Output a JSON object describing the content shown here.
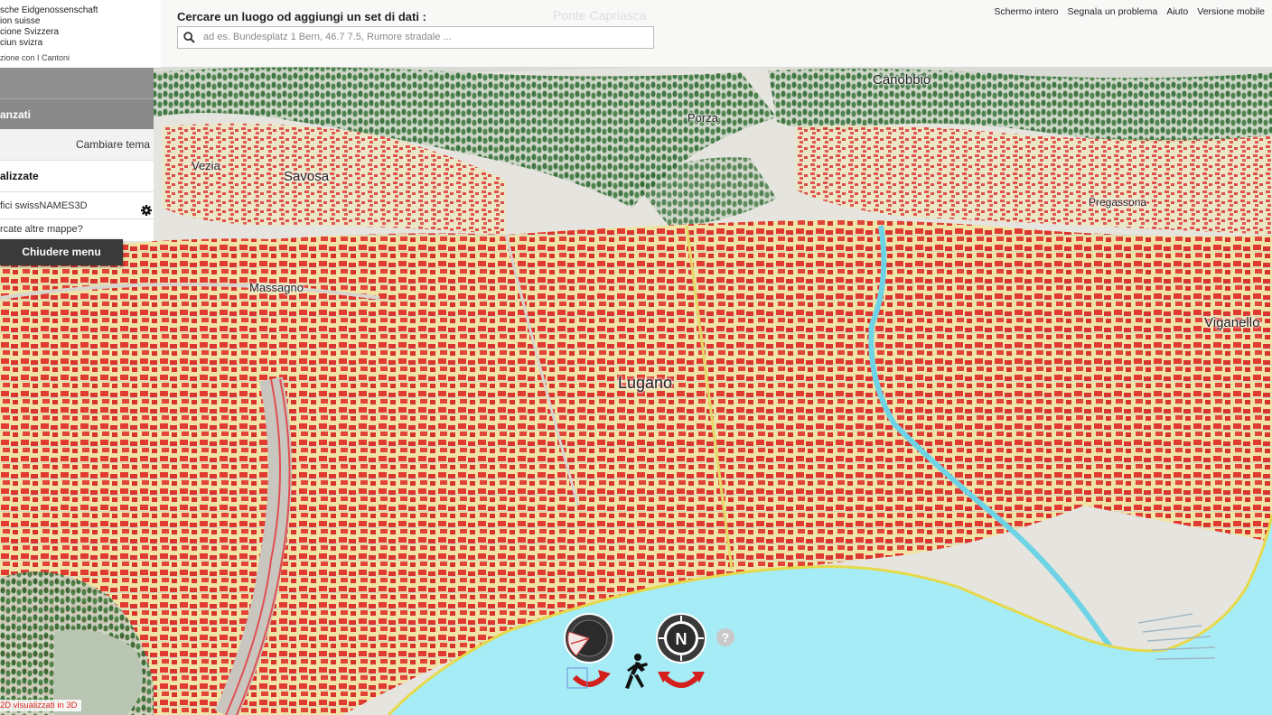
{
  "logo": {
    "lines": [
      "sche Eidgenossenschaft",
      "ion suisse",
      "cione Svizzera",
      "ciun svizra",
      "zione con I Cantoni"
    ]
  },
  "search": {
    "label": "Cercare un luogo od aggiungi un set di dati :",
    "placeholder": "ad es. Bundesplatz 1 Bern, 46.7 7.5, Rumore stradale ...",
    "value": ""
  },
  "top_links": [
    "Schermo intero",
    "Segnala un problema",
    "Aiuto",
    "Versione mobile"
  ],
  "sidebar": {
    "advanced_label": "anzati",
    "change_theme": "Cambiare tema",
    "visualized_label": "alizzate",
    "layer_name": "fici swissNAMES3D",
    "more_maps": "rcate altre mappe?",
    "close_menu": "Chiudere menu"
  },
  "places": [
    {
      "name": "Ponte Capriasca"
    },
    {
      "name": "Canobbio"
    },
    {
      "name": "Porza"
    },
    {
      "name": "Vezia"
    },
    {
      "name": "Savosa"
    },
    {
      "name": "Pregassona"
    },
    {
      "name": "Massagno"
    },
    {
      "name": "Viganello"
    },
    {
      "name": "Lugano"
    }
  ],
  "notice": "2D visualizzati in 3D",
  "controls": {
    "compass_label": "N",
    "help_label": "?"
  },
  "colors": {
    "lake": "#a6ecf6",
    "roof": "#e03a33",
    "wall": "#efe2a0",
    "tree": "#3e6f3f",
    "terrain": "#e7e5df"
  }
}
